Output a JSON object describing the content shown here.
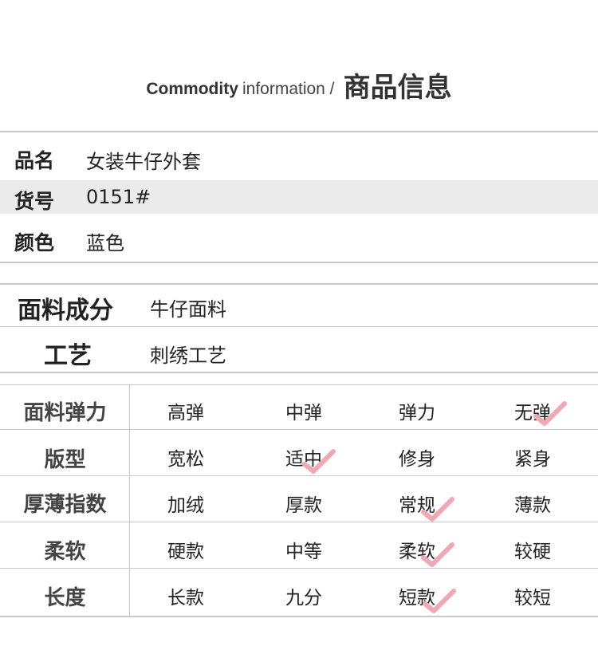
{
  "header": {
    "title_en_bold": "Commodity",
    "title_en_light": "information /",
    "title_cn": "商品信息"
  },
  "basic_info": [
    {
      "label": "品名",
      "value": "女装牛仔外套"
    },
    {
      "label": "货号",
      "value": "0151#"
    },
    {
      "label": "颜色",
      "value": "蓝色"
    }
  ],
  "material": {
    "label": "面料成分",
    "value": "牛仔面料"
  },
  "craft": {
    "label": "工艺",
    "value": "刺绣工艺"
  },
  "attributes": [
    {
      "label": "面料弹力",
      "options": [
        "高弹",
        "中弹",
        "弹力",
        "无弹"
      ],
      "selected": 3
    },
    {
      "label": "版型",
      "options": [
        "宽松",
        "适中",
        "修身",
        "紧身"
      ],
      "selected": 1
    },
    {
      "label": "厚薄指数",
      "options": [
        "加绒",
        "厚款",
        "常规",
        "薄款"
      ],
      "selected": 2
    },
    {
      "label": "柔软",
      "options": [
        "硬款",
        "中等",
        "柔软",
        "较硬"
      ],
      "selected": 2
    },
    {
      "label": "长度",
      "options": [
        "长款",
        "九分",
        "短款",
        "较短"
      ],
      "selected": 2
    }
  ],
  "check_icon": "checkmark-icon",
  "colors": {
    "check": "#f2a7b4",
    "line": "#c9c9c9",
    "shade": "#ebebeb"
  }
}
